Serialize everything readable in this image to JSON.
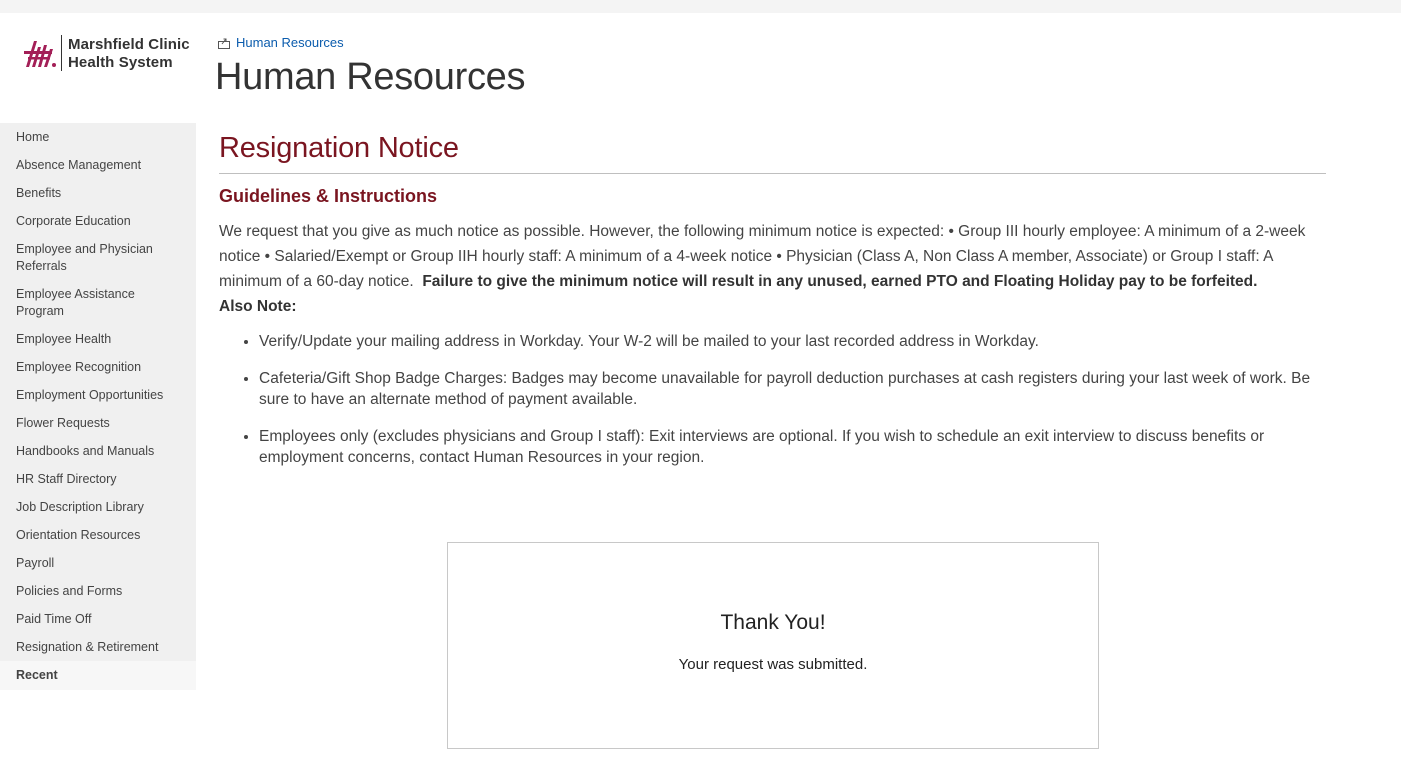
{
  "brand": {
    "name_line1": "Marshfield Clinic",
    "name_line2": "Health System",
    "color": "#a31f57"
  },
  "breadcrumb": {
    "label": "Human Resources"
  },
  "site": {
    "title": "Human Resources"
  },
  "nav": {
    "items": [
      {
        "label": "Home"
      },
      {
        "label": "Absence Management"
      },
      {
        "label": "Benefits"
      },
      {
        "label": "Corporate Education"
      },
      {
        "label": "Employee and Physician Referrals"
      },
      {
        "label": "Employee Assistance Program"
      },
      {
        "label": "Employee Health"
      },
      {
        "label": "Employee Recognition"
      },
      {
        "label": "Employment Opportunities"
      },
      {
        "label": "Flower Requests"
      },
      {
        "label": "Handbooks and Manuals"
      },
      {
        "label": "HR Staff Directory"
      },
      {
        "label": "Job Description Library"
      },
      {
        "label": "Orientation Resources"
      },
      {
        "label": "Payroll"
      },
      {
        "label": "Policies and Forms"
      },
      {
        "label": "Paid Time Off"
      },
      {
        "label": "Resignation & Retirement"
      }
    ],
    "recent_label": "Recent"
  },
  "page": {
    "heading": "Resignation Notice",
    "subheading": "Guidelines & Instructions",
    "intro_text": "We request that you give as much notice as possible. However, the following minimum notice is expected: • Group III hourly employee: A minimum of a 2-week notice • Salaried/Exempt or Group IIH hourly staff: A minimum of a 4-week notice • Physician (Class A, Non Class A member, Associate) or Group I staff: A minimum of a 60-day notice.",
    "warning": "Failure to give the minimum notice will result in any unused, earned PTO and Floating Holiday pay to be forfeited.",
    "also_note": "Also Note:",
    "bullets": [
      "Verify/Update your mailing address in Workday. Your W-2 will be mailed to your last recorded address in Workday.",
      "Cafeteria/Gift Shop Badge Charges:  Badges may become unavailable for payroll deduction purchases at cash registers during your last week of work. Be sure to have an alternate method of payment available.",
      "Employees only (excludes physicians and Group I staff): Exit interviews are optional. If you wish to schedule an exit interview to discuss benefits or employment concerns, contact Human Resources in your region."
    ]
  },
  "confirmation": {
    "title": "Thank You!",
    "message": "Your request was submitted."
  },
  "colors": {
    "heading": "#7a1520",
    "link": "#0b5cad",
    "nav_bg": "#f0f0f0"
  }
}
